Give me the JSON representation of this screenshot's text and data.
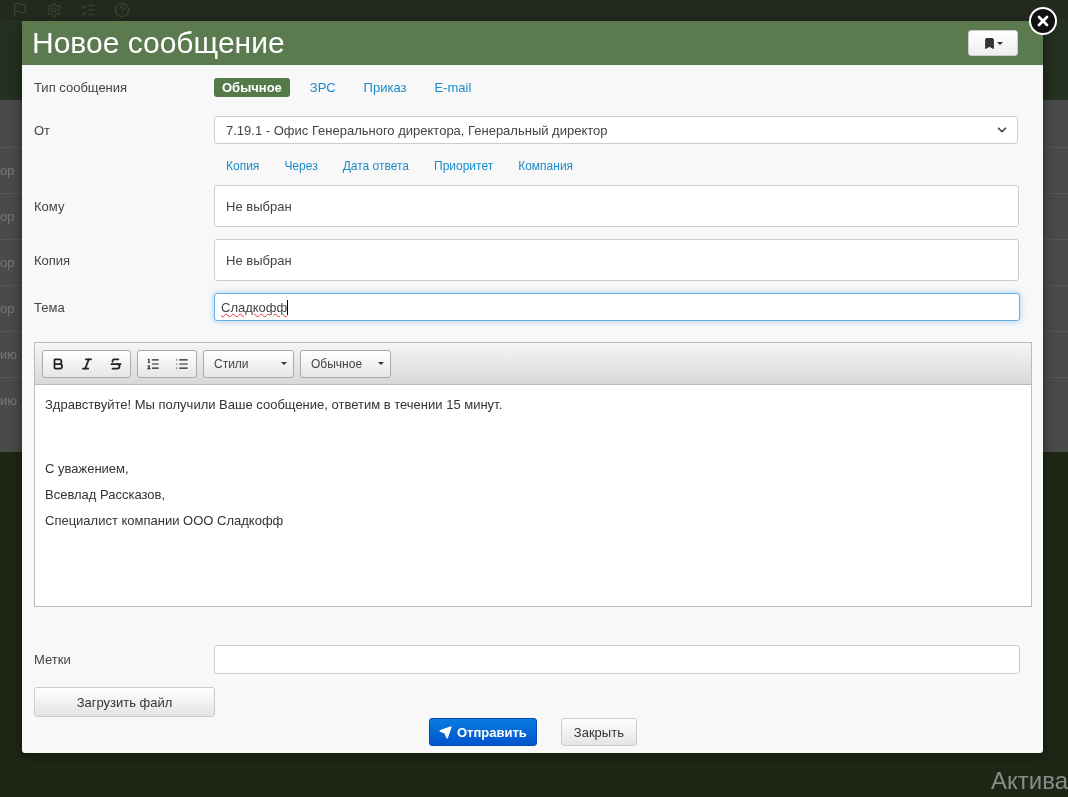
{
  "window": {
    "title": "Новое сообщение"
  },
  "message_type": {
    "label": "Тип сообщения",
    "options": [
      {
        "label": "Обычное",
        "selected": true
      },
      {
        "label": "ЗРС",
        "selected": false
      },
      {
        "label": "Приказ",
        "selected": false
      },
      {
        "label": "E-mail",
        "selected": false
      }
    ]
  },
  "from": {
    "label": "От",
    "value": "7.19.1 - Офис Генерального директора, Генеральный директор"
  },
  "extra_fields": [
    "Копия",
    "Через",
    "Дата ответа",
    "Приоритет",
    "Компания"
  ],
  "recipients": [
    {
      "label": "Кому",
      "value": "Не выбран"
    },
    {
      "label": "Копия",
      "value": "Не выбран"
    }
  ],
  "subject": {
    "label": "Тема",
    "value": "Сладкофф",
    "focused": true
  },
  "editor": {
    "dropdowns": [
      {
        "label": "Стили"
      },
      {
        "label": "Обычное"
      }
    ],
    "blocks": [
      {
        "lines": [
          "Здравствуйте! Мы получили Ваше сообщение, ответим в течении 15 минут."
        ]
      },
      {
        "lines": [
          "С уважением,",
          "Всевлад Рассказов,",
          "Специалист компании ООО Сладкофф"
        ]
      }
    ]
  },
  "tags": {
    "label": "Метки"
  },
  "upload_button": "Загрузить файл",
  "actions": [
    {
      "label": "Отправить",
      "kind": "primary"
    },
    {
      "label": "Закрыть",
      "kind": "default"
    }
  ],
  "background": {
    "row_fragments": [
      "ор",
      "ор",
      "ор",
      "ор",
      "ию",
      "ию"
    ],
    "corner_text": "Актива"
  }
}
